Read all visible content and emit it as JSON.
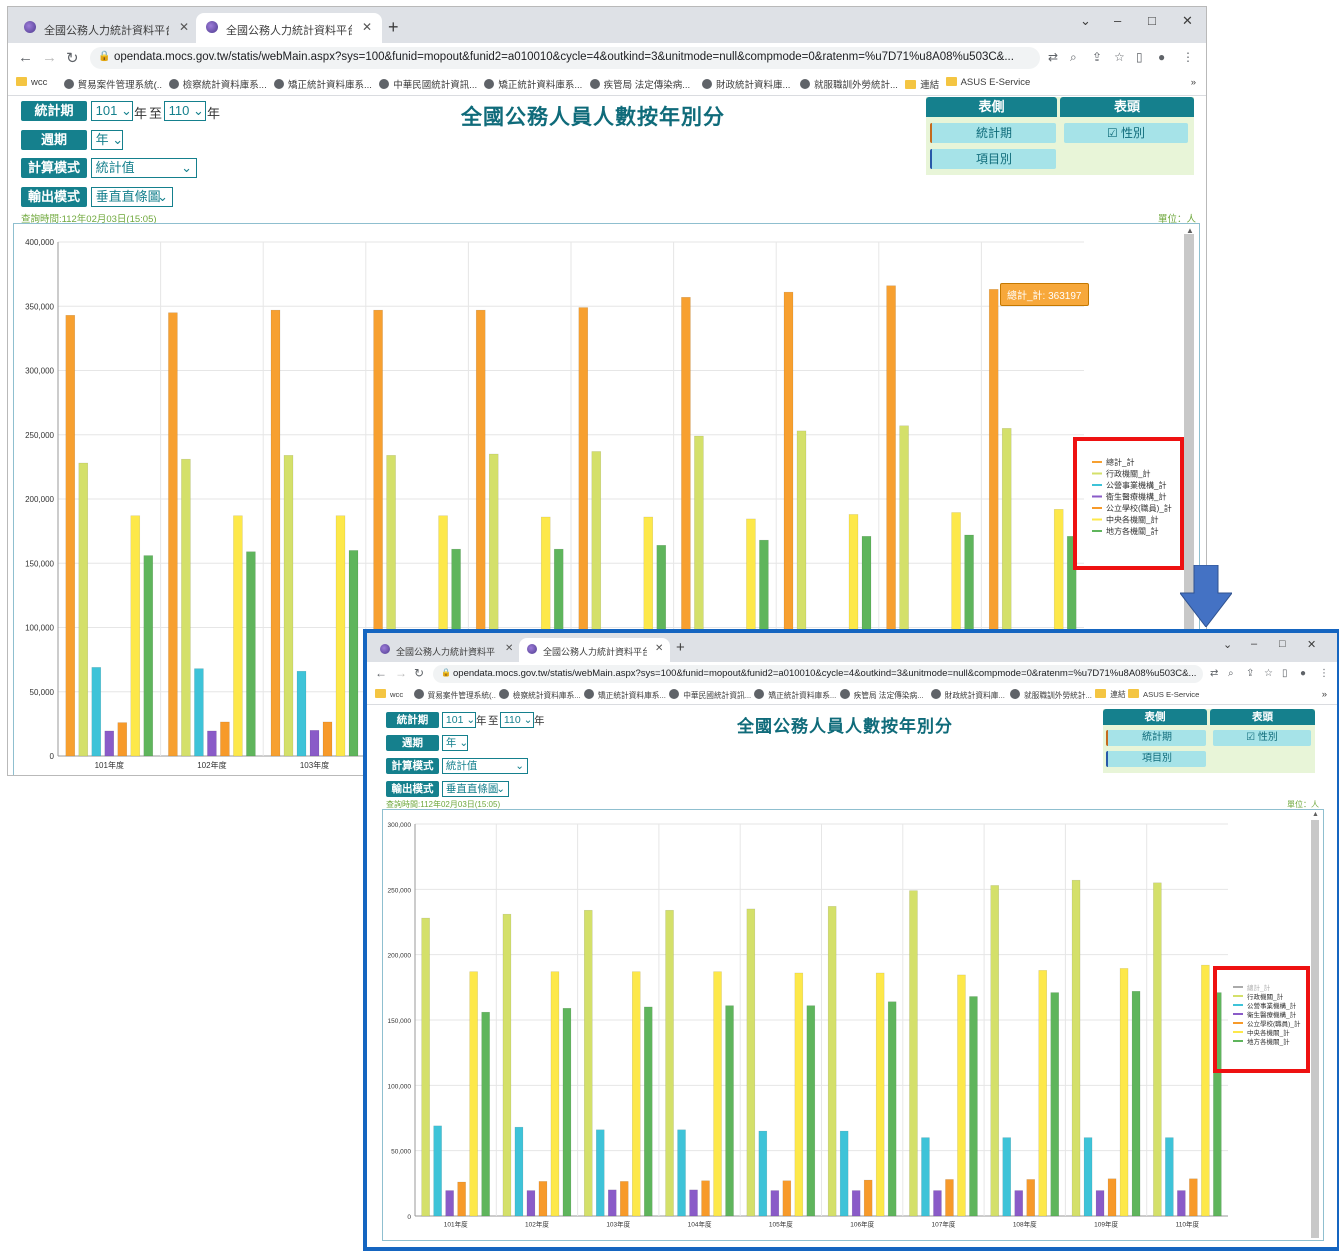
{
  "browser": {
    "tabs": [
      {
        "title": "全國公務人力統計資料平台",
        "active": false
      },
      {
        "title": "全國公務人力統計資料平台查詢網",
        "active": true
      }
    ],
    "new_tab": "+",
    "window_controls": {
      "minimize": "–",
      "maximize": "□",
      "close": "✕",
      "menu": "⌄"
    },
    "url": "opendata.mocs.gov.tw/statis/webMain.aspx?sys=100&funid=mopout&funid2=a010010&cycle=4&outkind=3&unitmode=null&compmode=0&ratenm=%u7D71%u8A08%u503C&...",
    "bookmarks": [
      {
        "label": "wcc",
        "icon": "folder-icon"
      },
      {
        "label": "貿易案件管理系統(..",
        "icon": "globe-icon"
      },
      {
        "label": "檢察統計資料庫系...",
        "icon": "globe-icon"
      },
      {
        "label": "矯正統計資料庫系...",
        "icon": "globe-icon"
      },
      {
        "label": "中華民國統計資訊...",
        "icon": "chart-icon"
      },
      {
        "label": "矯正統計資料庫系...",
        "icon": "globe-icon"
      },
      {
        "label": "疾管局 法定傳染病...",
        "icon": "globe-icon"
      },
      {
        "label": "財政統計資料庫...",
        "icon": "globe-icon"
      },
      {
        "label": "就服職訓外勞統計...",
        "icon": "globe-icon"
      },
      {
        "label": "連結",
        "icon": "folder-icon"
      },
      {
        "label": "ASUS E-Service",
        "icon": "folder-icon"
      }
    ],
    "bookmarks_more": "»"
  },
  "page": {
    "title": "全國公務人員人數按年別分",
    "stat_period": {
      "label": "統計期",
      "from": "101",
      "to": "110",
      "unit_year": "年",
      "between": "至"
    },
    "cycle": {
      "label": "週期",
      "value": "年"
    },
    "calc_mode": {
      "label": "計算模式",
      "value": "統計值"
    },
    "output_mode": {
      "label": "輸出模式",
      "value": "垂直直條圖"
    },
    "side_panel": {
      "header_left": "表側",
      "header_right": "表頭",
      "stat_period_btn": "統計期",
      "item_btn": "項目別",
      "gender_btn": "☑ 性別"
    },
    "query_time": "查詢時間:112年02月03日(15:05)",
    "unit": "單位：人",
    "tooltip": "總計_計: 363197"
  },
  "colors": {
    "teal": "#15808d",
    "highlight_red": "#ee1111",
    "frame_blue": "#1565c0",
    "arrow_blue": "#4472c4"
  },
  "chart_data": [
    {
      "type": "bar",
      "categories": [
        "101年度",
        "102年度",
        "103年度",
        "104年度",
        "105年度",
        "106年度",
        "107年度",
        "108年度",
        "109年度",
        "110年度"
      ],
      "ylim": [
        0,
        400000
      ],
      "yticks": [
        "0",
        "50,000",
        "100,000",
        "150,000",
        "200,000",
        "250,000",
        "300,000",
        "350,000",
        "400,000"
      ],
      "series": [
        {
          "name": "總計_計",
          "color": "#f7a030",
          "values": [
            343000,
            345000,
            347000,
            347000,
            347000,
            349000,
            357000,
            361000,
            366000,
            363197
          ]
        },
        {
          "name": "行政機關_計",
          "color": "#d4e06a",
          "values": [
            228000,
            231000,
            234000,
            234000,
            235000,
            237000,
            249000,
            253000,
            257000,
            255000
          ]
        },
        {
          "name": "公營事業機構_計",
          "color": "#3ec3d8",
          "values": [
            69000,
            68000,
            66000,
            66000,
            65000,
            65000,
            60000,
            60000,
            60000,
            60000
          ]
        },
        {
          "name": "衛生醫療機構_計",
          "color": "#8a5bc8",
          "values": [
            19500,
            19500,
            20000,
            20000,
            19500,
            19500,
            19500,
            19500,
            19500,
            19500
          ]
        },
        {
          "name": "公立學校(職員)_計",
          "color": "#f79a2a",
          "values": [
            26000,
            26500,
            26500,
            27000,
            27000,
            27500,
            28000,
            28000,
            28500,
            28500
          ]
        },
        {
          "name": "中央各機關_計",
          "color": "#fde84a",
          "values": [
            187000,
            187000,
            187000,
            187000,
            186000,
            186000,
            184500,
            188000,
            189500,
            192000
          ]
        },
        {
          "name": "地方各機關_計",
          "color": "#5fb55c",
          "values": [
            156000,
            159000,
            160000,
            161000,
            161000,
            164000,
            168000,
            171000,
            172000,
            171000
          ]
        }
      ]
    },
    {
      "type": "bar",
      "categories": [
        "101年度",
        "102年度",
        "103年度",
        "104年度",
        "105年度",
        "106年度",
        "107年度",
        "108年度",
        "109年度",
        "110年度"
      ],
      "ylim": [
        0,
        300000
      ],
      "yticks": [
        "0",
        "50,000",
        "100,000",
        "150,000",
        "200,000",
        "250,000",
        "300,000"
      ],
      "series": [
        {
          "name": "總計_計",
          "color": "#f7a030",
          "hidden": true,
          "values": [
            343000,
            345000,
            347000,
            347000,
            347000,
            349000,
            357000,
            361000,
            366000,
            363197
          ]
        },
        {
          "name": "行政機關_計",
          "color": "#d4e06a",
          "values": [
            228000,
            231000,
            234000,
            234000,
            235000,
            237000,
            249000,
            253000,
            257000,
            255000
          ]
        },
        {
          "name": "公營事業機構_計",
          "color": "#3ec3d8",
          "values": [
            69000,
            68000,
            66000,
            66000,
            65000,
            65000,
            60000,
            60000,
            60000,
            60000
          ]
        },
        {
          "name": "衛生醫療機構_計",
          "color": "#8a5bc8",
          "values": [
            19500,
            19500,
            20000,
            20000,
            19500,
            19500,
            19500,
            19500,
            19500,
            19500
          ]
        },
        {
          "name": "公立學校(職員)_計",
          "color": "#f79a2a",
          "values": [
            26000,
            26500,
            26500,
            27000,
            27000,
            27500,
            28000,
            28000,
            28500,
            28500
          ]
        },
        {
          "name": "中央各機關_計",
          "color": "#fde84a",
          "values": [
            187000,
            187000,
            187000,
            187000,
            186000,
            186000,
            184500,
            188000,
            189500,
            192000
          ]
        },
        {
          "name": "地方各機關_計",
          "color": "#5fb55c",
          "values": [
            156000,
            159000,
            160000,
            161000,
            161000,
            164000,
            168000,
            171000,
            172000,
            171000
          ]
        }
      ]
    }
  ]
}
